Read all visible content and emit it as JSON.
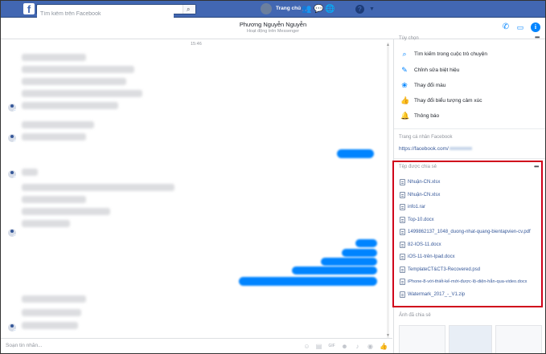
{
  "topbar": {
    "logo": "f",
    "search_placeholder": "Tìm kiếm trên Facebook",
    "home_label": "Trang chủ",
    "home_badge": "2",
    "icons": [
      "friends-icon",
      "messenger-icon",
      "globe-icon",
      "help-icon",
      "dropdown-icon"
    ],
    "brand_color": "#4267b2"
  },
  "conversation": {
    "name": "Phương Nguyễn Nguyễn",
    "status": "Hoạt động trên Messenger",
    "timestamp": "15:46"
  },
  "composer": {
    "placeholder": "Soạn tin nhắn..."
  },
  "sidebar": {
    "options_title": "Tùy chọn",
    "options": [
      {
        "icon": "search-icon",
        "label": "Tìm kiếm trong cuộc trò chuyện"
      },
      {
        "icon": "pencil-icon",
        "label": "Chỉnh sửa biệt hiệu"
      },
      {
        "icon": "palette-icon",
        "label": "Thay đổi màu"
      },
      {
        "icon": "thumbs-up-icon",
        "label": "Thay đổi biểu tượng cảm xúc"
      },
      {
        "icon": "bell-icon",
        "label": "Thông báo"
      }
    ],
    "profile_title": "Trang cá nhân Facebook",
    "profile_link": "https://facebook.com/",
    "files_title": "Tệp được chia sẻ",
    "files": [
      "Nhuận-CN.xlsx",
      "Nhuận-CN.xlsx",
      "info1.rar",
      "Top-10.docx",
      "1499862137_1048_duong-nhat-quang-bientapvien-cv.pdf",
      "82-IOS-11.docx",
      "iOS-11-trên-Ipad.docx",
      "TemplateCT&CT3-Recovered.psd",
      "iPhone-8-với-thiết-kế-mới-được-lộ-diện-hẳn-qua-video.docx",
      "Watermark_2017_-_V1.zip"
    ],
    "photos_title": "Ảnh đã chia sẻ",
    "highlight_color": "#d0021b"
  }
}
